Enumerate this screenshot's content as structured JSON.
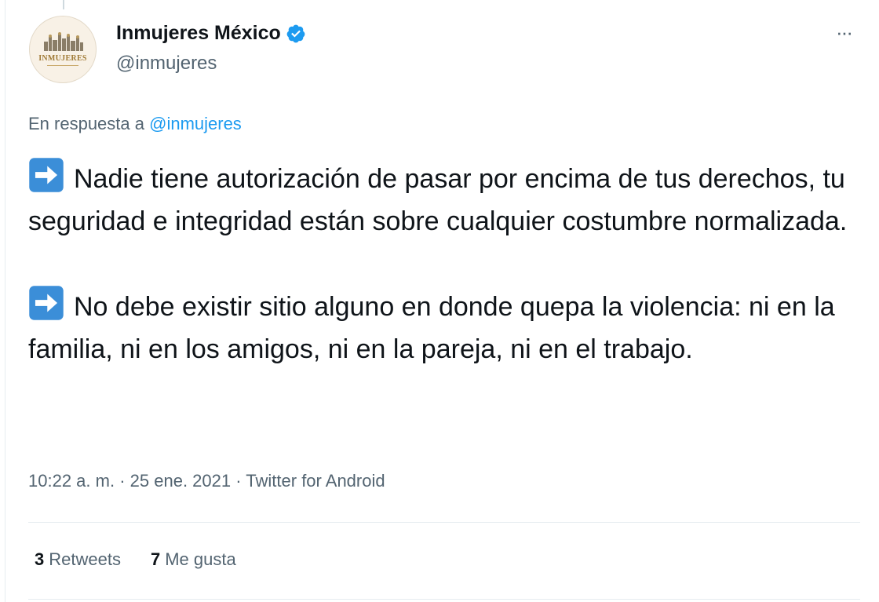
{
  "author": {
    "display_name": "Inmujeres México",
    "handle": "@inmujeres",
    "verified": true,
    "avatar_logo_text": "INMUJERES"
  },
  "menu": {
    "more_label": "···"
  },
  "reply": {
    "prefix": "En respuesta a",
    "handle": "@inmujeres"
  },
  "tweet": {
    "paragraphs": [
      {
        "icon": "right-arrow-emoji",
        "text": "Nadie tiene autorización de pasar por encima de tus derechos, tu seguridad e integridad están sobre cualquier costumbre normalizada."
      },
      {
        "icon": "right-arrow-emoji",
        "text": "No debe existir sitio alguno en donde quepa la violencia: ni en la familia, ni en los amigos, ni en la pareja, ni en el trabajo."
      }
    ]
  },
  "meta": {
    "time": "10:22 a. m.",
    "separator": "·",
    "date": "25 ene. 2021",
    "source": "Twitter for Android"
  },
  "stats": {
    "retweets_count": "3",
    "retweets_label": "Retweets",
    "likes_count": "7",
    "likes_label": "Me gusta"
  },
  "colors": {
    "text": "#0f1419",
    "secondary": "#536471",
    "link": "#1d9bf0",
    "verified": "#1d9bf0",
    "emoji_bg": "#3b8ed8",
    "divider": "#e6ecf0"
  }
}
